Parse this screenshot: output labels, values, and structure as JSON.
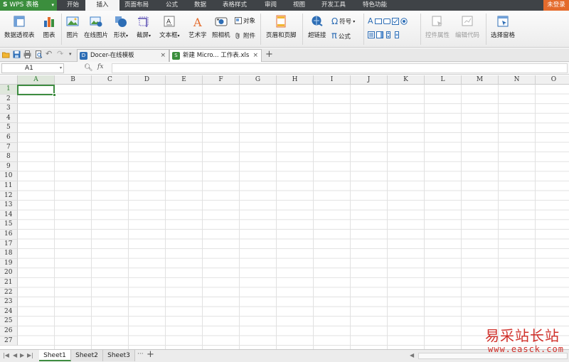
{
  "app": {
    "name": "WPS 表格",
    "logo_letter": "S"
  },
  "menu": {
    "tabs": [
      "开始",
      "插入",
      "页面布局",
      "公式",
      "数据",
      "表格样式",
      "审阅",
      "视图",
      "开发工具",
      "特色功能"
    ],
    "active": "插入",
    "login": "未登录"
  },
  "ribbon": {
    "pivot": "数据透视表",
    "chart": "图表",
    "picture": "图片",
    "online_picture": "在线图片",
    "shapes": "形状",
    "screenshot": "截屏",
    "textbox": "文本框",
    "wordart": "艺术字",
    "camera": "照相机",
    "object": "对象",
    "attachment": "附件",
    "header_footer": "页眉和页脚",
    "hyperlink": "超链接",
    "symbol": "符号",
    "formula": "公式",
    "control_props": "控件属性",
    "edit_code": "编辑代码",
    "select_pane": "选择窗格",
    "symbol_glyph": "Ω",
    "formula_glyph": "π"
  },
  "doc_tabs": [
    {
      "title": "Docer-在线模板",
      "icon": "D",
      "icon_color": "#2d6db5"
    },
    {
      "title": "新建 Micro... 工作表.xls",
      "icon": "S",
      "icon_color": "#3b8e3d"
    }
  ],
  "formula_bar": {
    "cell_ref": "A1",
    "fx": "fx",
    "value": ""
  },
  "columns": [
    "A",
    "B",
    "C",
    "D",
    "E",
    "F",
    "G",
    "H",
    "I",
    "J",
    "K",
    "L",
    "M",
    "N",
    "O"
  ],
  "rows": [
    "1",
    "2",
    "3",
    "4",
    "5",
    "6",
    "7",
    "8",
    "9",
    "10",
    "11",
    "12",
    "13",
    "14",
    "15",
    "16",
    "17",
    "18",
    "19",
    "20",
    "21",
    "22",
    "23",
    "24",
    "25",
    "26",
    "27"
  ],
  "selected_cell": {
    "col": "A",
    "row": "1"
  },
  "sheets": [
    "Sheet1",
    "Sheet2",
    "Sheet3"
  ],
  "active_sheet": "Sheet1",
  "sheet_more": "···",
  "watermark": {
    "logo": "易采站长站",
    "url": "www.easck.com"
  },
  "colors": {
    "accent": "#3d8c40",
    "menubar": "#3f4347",
    "login": "#e46b2c",
    "watermark": "#d0302a"
  }
}
